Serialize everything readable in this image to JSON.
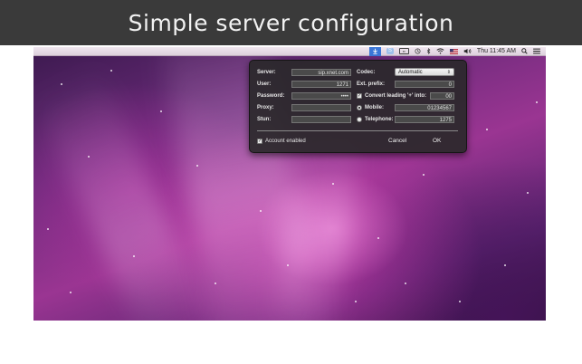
{
  "banner": {
    "title": "Simple server configuration"
  },
  "menubar": {
    "clock": "Thu 11:45 AM",
    "icons": [
      "app-telephone-icon",
      "status-blue-icon",
      "keyboard-icon",
      "time-machine-icon",
      "bluetooth-icon",
      "wifi-icon",
      "flag-icon",
      "volume-icon",
      "spotlight-icon",
      "list-icon"
    ]
  },
  "form": {
    "server_label": "Server:",
    "server_value": "sip.xnet.com",
    "user_label": "User:",
    "user_value": "1271",
    "password_label": "Password:",
    "password_value": "••••",
    "proxy_label": "Proxy:",
    "proxy_value": "",
    "stun_label": "Stun:",
    "stun_value": "",
    "codec_label": "Codec:",
    "codec_value": "Automatic",
    "ext_prefix_label": "Ext. prefix:",
    "ext_prefix_value": "0",
    "convert_label": "Convert leading '+' into:",
    "convert_value": "00",
    "convert_checked": true,
    "mobile_label": "Mobile:",
    "mobile_value": "01234567",
    "mobile_selected": true,
    "telephone_label": "Telephone:",
    "telephone_value": "1275",
    "telephone_selected": false,
    "account_enabled_label": "Account enabled",
    "account_enabled_checked": true,
    "cancel_label": "Cancel",
    "ok_label": "OK"
  }
}
